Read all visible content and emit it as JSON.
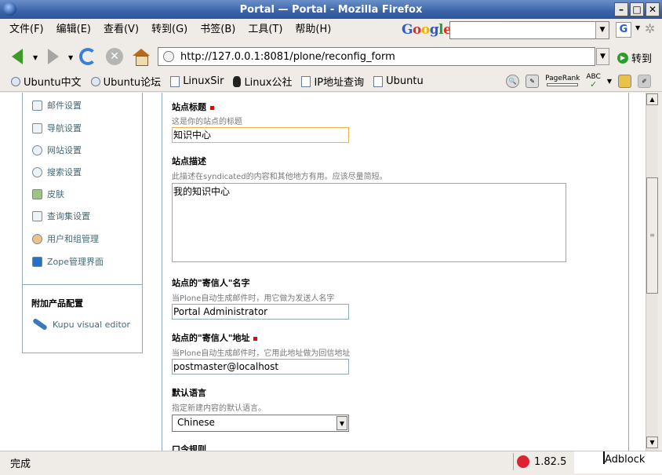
{
  "window": {
    "title": "Portal — Portal - Mozilla Firefox"
  },
  "menu": [
    "文件(F)",
    "编辑(E)",
    "查看(V)",
    "转到(G)",
    "书签(B)",
    "工具(T)",
    "帮助(H)"
  ],
  "search": {
    "engine_logo": "Google",
    "engine_icon": "G",
    "value": ""
  },
  "nav": {
    "url": "http://127.0.0.1:8081/plone/reconfig_form",
    "go_label": "转到"
  },
  "bookmarks": [
    "Ubuntu中文",
    "Ubuntu论坛",
    "LinuxSir",
    "Linux公社",
    "IP地址查询",
    "Ubuntu"
  ],
  "toolbar_extra": {
    "pagerank_label": "PageRank",
    "abc_label": "ABC"
  },
  "portlet": {
    "items": [
      "邮件设置",
      "导航设置",
      "网站设置",
      "搜索设置",
      "皮肤",
      "查询集设置",
      "用户和组管理",
      "Zope管理界面"
    ],
    "addon_header": "附加产品配置",
    "addon_item": "Kupu visual editor"
  },
  "form": {
    "site_title_label": "站点标题",
    "site_title_help": "这是你的站点的标题",
    "site_title_value": "知识中心",
    "site_desc_label": "站点描述",
    "site_desc_help": "此描述在syndicated的内容和其他地方有用。应该尽量简短。",
    "site_desc_value": "我的知识中心",
    "from_name_label": "站点的\"寄信人\"名字",
    "from_name_help": "当Plone自动生成邮件时，用它做为发送人名字",
    "from_name_value": "Portal Administrator",
    "from_addr_label": "站点的\"寄信人\"地址",
    "from_addr_help": "当Plone自动生成邮件时，它用此地址做为回信地址",
    "from_addr_value": "postmaster@localhost",
    "lang_label": "默认语言",
    "lang_help": "指定新建内容的默认语言。",
    "lang_value": "Chinese",
    "next_label_partial": "口令规则"
  },
  "status": {
    "text": "完成",
    "download": "1.82.5",
    "adblock": "Adblock"
  }
}
